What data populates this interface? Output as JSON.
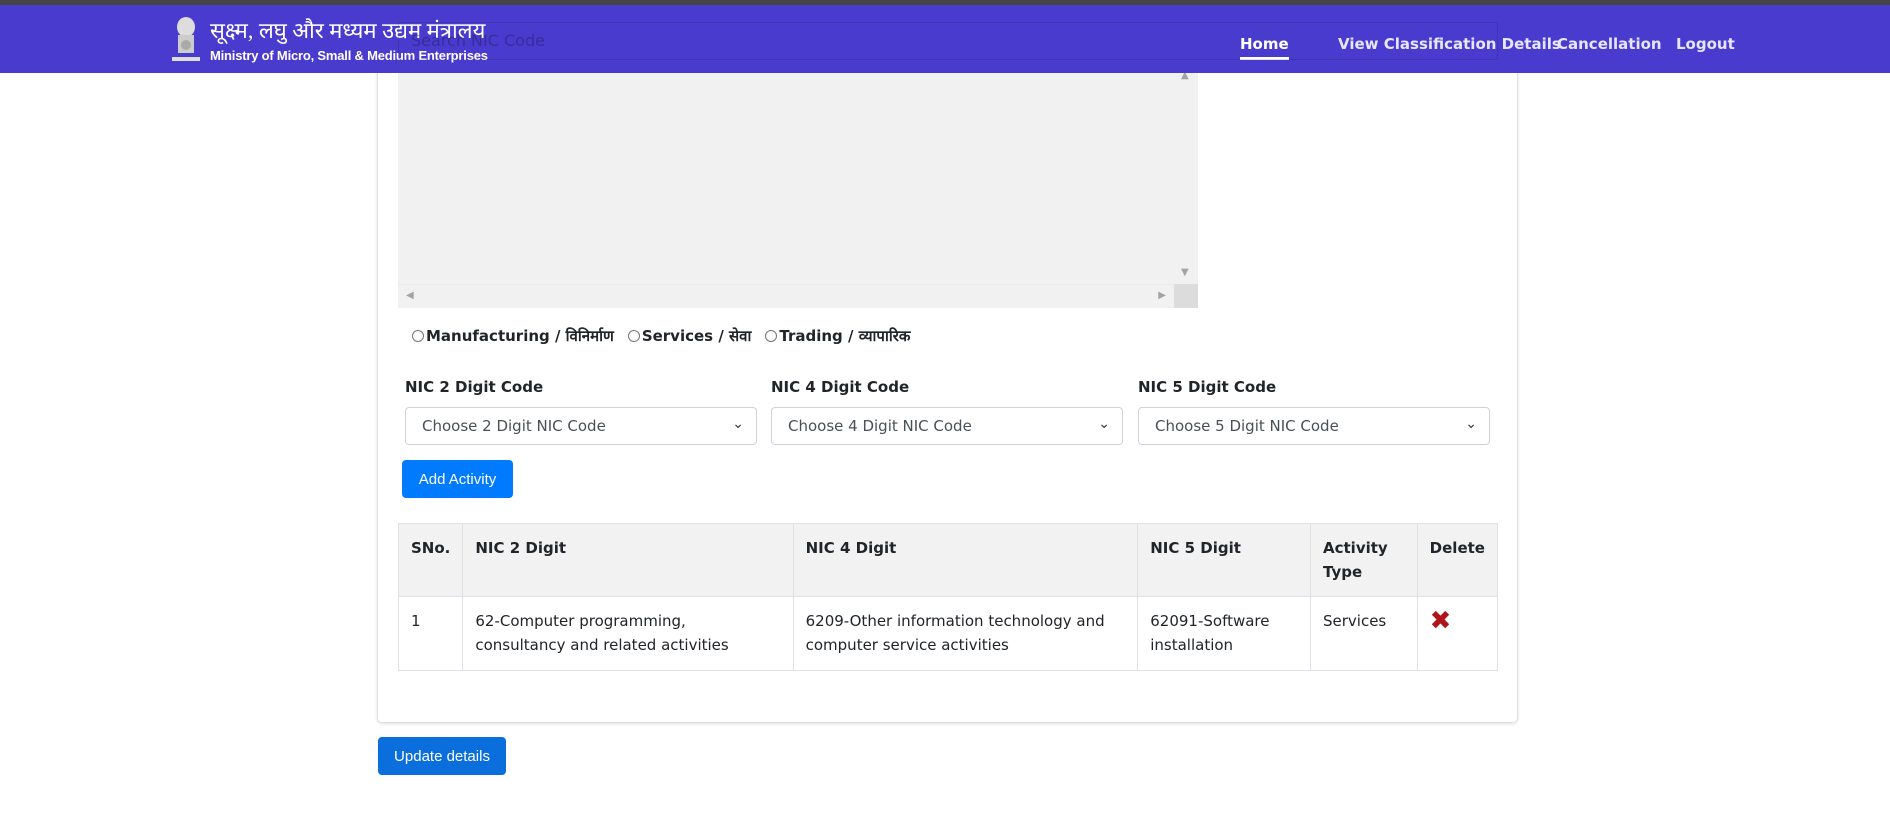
{
  "header": {
    "brand_hindi": "सूक्ष्म, लघु और मध्यम उद्यम मंत्रालय",
    "brand_english": "Ministry of Micro, Small & Medium Enterprises",
    "nav": [
      {
        "label": "Home",
        "active": true
      },
      {
        "label": "View Classification Details"
      },
      {
        "label": "Cancellation"
      },
      {
        "label": "Logout"
      }
    ]
  },
  "search": {
    "placeholder": "Search NIC Code"
  },
  "activity_types": [
    {
      "label": "Manufacturing / विनिर्माण"
    },
    {
      "label": "Services / सेवा"
    },
    {
      "label": "Trading / व्यापारिक"
    }
  ],
  "fields": [
    {
      "label": "NIC 2 Digit Code",
      "placeholder": "Choose 2 Digit NIC Code"
    },
    {
      "label": "NIC 4 Digit Code",
      "placeholder": "Choose 4 Digit NIC Code"
    },
    {
      "label": "NIC 5 Digit Code",
      "placeholder": "Choose 5 Digit NIC Code"
    }
  ],
  "add_activity_label": "Add Activity",
  "table": {
    "headers": [
      "SNo.",
      "NIC 2 Digit",
      "NIC 4 Digit",
      "NIC 5 Digit",
      "Activity Type",
      "Delete"
    ],
    "rows": [
      [
        "1",
        "62-Computer programming, consultancy and related activities",
        "6209-Other information technology and computer service activities",
        "62091-Software installation",
        "Services"
      ]
    ]
  },
  "update_label": "Update details",
  "colors": {
    "header": "#4a3bcf",
    "primary": "#007bff",
    "delete": "#b0141a"
  },
  "icons": {
    "delete": "red-x-icon",
    "emblem": "national-emblem"
  }
}
